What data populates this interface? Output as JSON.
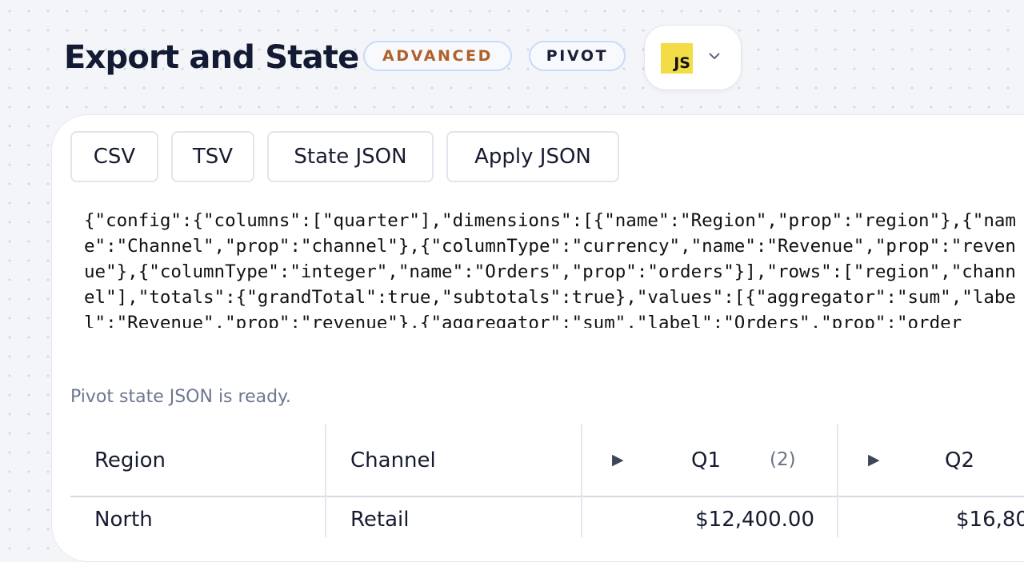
{
  "header": {
    "title": "Export and State",
    "badges": [
      "ADVANCED",
      "PIVOT"
    ],
    "language": "JS"
  },
  "toolbar": {
    "csv": "CSV",
    "tsv": "TSV",
    "state_json": "State JSON",
    "apply_json": "Apply JSON"
  },
  "json_output": "{\"config\":{\"columns\":[\"quarter\"],\"dimensions\":[{\"name\":\"Region\",\"prop\":\"region\"},{\"name\":\"Channel\",\"prop\":\"channel\"},{\"columnType\":\"currency\",\"name\":\"Revenue\",\"prop\":\"revenue\"},{\"columnType\":\"integer\",\"name\":\"Orders\",\"prop\":\"orders\"}],\"rows\":[\"region\",\"channel\"],\"totals\":{\"grandTotal\":true,\"subtotals\":true},\"values\":[{\"aggregator\":\"sum\",\"label\":\"Revenue\",\"prop\":\"revenue\"},{\"aggregator\":\"sum\",\"label\":\"Orders\",\"prop\":\"orders\"}]},\"kind\":\"revogrid:pivot.state\"}",
  "status": "Pivot state JSON is ready.",
  "grid": {
    "headers": {
      "region": "Region",
      "channel": "Channel",
      "q1": "Q1",
      "q1_count": "(2)",
      "q2": "Q2"
    },
    "expand_glyph": "▶",
    "rows": [
      {
        "region": "North",
        "channel": "Retail",
        "q1": "$12,400.00",
        "q2": "$16,80"
      }
    ]
  },
  "colors": {
    "background": "#f4f5f8",
    "accent_badge": "#b0602a",
    "badge_border": "#c9daf6",
    "js_logo": "#f2dd47",
    "status_text": "#6d7790"
  }
}
